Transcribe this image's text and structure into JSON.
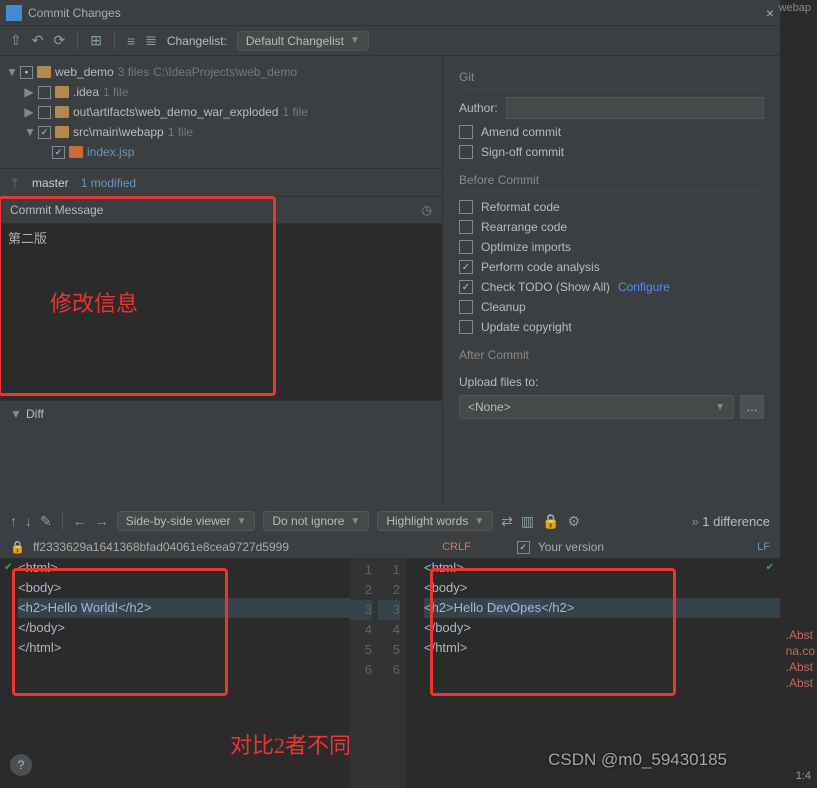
{
  "window": {
    "title": "Commit Changes"
  },
  "toolbar": {
    "changelist_label": "Changelist:",
    "changelist_value": "Default Changelist"
  },
  "tree": {
    "root": {
      "name": "web_demo",
      "files": "3 files",
      "path": "C:\\IdeaProjects\\web_demo"
    },
    "nodes": [
      {
        "name": ".idea",
        "hint": "1 file",
        "checked": false,
        "depth": 1
      },
      {
        "name": "out\\artifacts\\web_demo_war_exploded",
        "hint": "1 file",
        "checked": false,
        "depth": 1
      },
      {
        "name": "src\\main\\webapp",
        "hint": "1 file",
        "checked": true,
        "depth": 1,
        "expanded": true
      },
      {
        "name": "index.jsp",
        "hint": "",
        "checked": true,
        "depth": 2,
        "file": true
      }
    ]
  },
  "branch": {
    "name": "master",
    "modified": "1 modified",
    "arrow": "⌄"
  },
  "commit_message": {
    "header": "Commit Message",
    "text": "第二版"
  },
  "annotations": {
    "msg": "修改信息",
    "diff": "对比2者不同"
  },
  "diff": {
    "header": "Diff",
    "viewer": "Side-by-side viewer",
    "ignore": "Do not ignore",
    "highlight": "Highlight words",
    "count": "1 difference",
    "file_hash": "ff2333629a1641368bfad04061e8cea9727d5999",
    "left_enc": "CRLF",
    "right_label": "Your version",
    "right_enc": "LF",
    "left_lines": [
      "<html>",
      "<body>",
      "<h2>Hello World!</h2>",
      "</body>",
      "</html>",
      ""
    ],
    "right_lines": [
      "<html>",
      "<body>",
      "<h2>Hello DevOpes</h2>",
      "</body>",
      "</html>",
      ""
    ],
    "left_word": "World!",
    "right_word": "DevOpes"
  },
  "git": {
    "section": "Git",
    "author_label": "Author:",
    "amend": "Amend commit",
    "signoff": "Sign-off commit"
  },
  "before": {
    "section": "Before Commit",
    "items": [
      {
        "label": "Reformat code",
        "checked": false
      },
      {
        "label": "Rearrange code",
        "checked": false
      },
      {
        "label": "Optimize imports",
        "checked": false
      },
      {
        "label": "Perform code analysis",
        "checked": true
      },
      {
        "label": "Check TODO (Show All)",
        "checked": true,
        "link": "Configure"
      },
      {
        "label": "Cleanup",
        "checked": false
      },
      {
        "label": "Update copyright",
        "checked": false
      }
    ]
  },
  "after": {
    "section": "After Commit",
    "upload_label": "Upload files to:",
    "upload_value": "<None>"
  },
  "watermark": "CSDN @m0_59430185",
  "logs": [
    ".Abst",
    "na.co",
    ".Abst",
    ".Abst"
  ],
  "status": "1:4",
  "rightside_hint": "webap"
}
